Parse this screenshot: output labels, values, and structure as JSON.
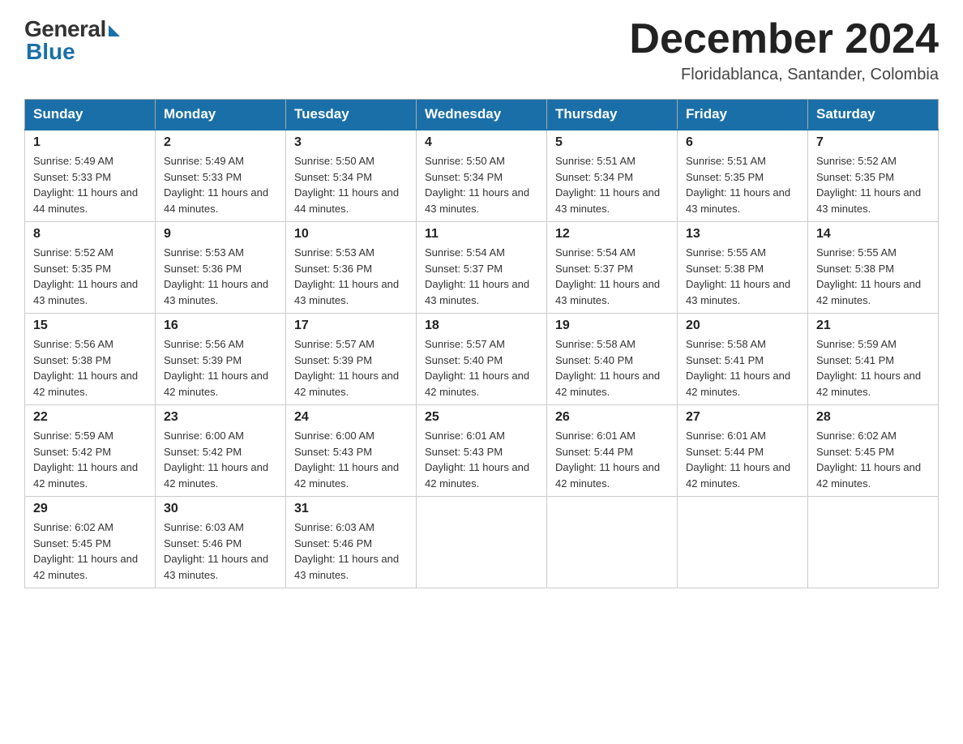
{
  "header": {
    "logo": {
      "general": "General",
      "blue": "Blue"
    },
    "title": "December 2024",
    "location": "Floridablanca, Santander, Colombia"
  },
  "days_of_week": [
    "Sunday",
    "Monday",
    "Tuesday",
    "Wednesday",
    "Thursday",
    "Friday",
    "Saturday"
  ],
  "weeks": [
    [
      {
        "day": "1",
        "sunrise": "5:49 AM",
        "sunset": "5:33 PM",
        "daylight": "11 hours and 44 minutes."
      },
      {
        "day": "2",
        "sunrise": "5:49 AM",
        "sunset": "5:33 PM",
        "daylight": "11 hours and 44 minutes."
      },
      {
        "day": "3",
        "sunrise": "5:50 AM",
        "sunset": "5:34 PM",
        "daylight": "11 hours and 44 minutes."
      },
      {
        "day": "4",
        "sunrise": "5:50 AM",
        "sunset": "5:34 PM",
        "daylight": "11 hours and 43 minutes."
      },
      {
        "day": "5",
        "sunrise": "5:51 AM",
        "sunset": "5:34 PM",
        "daylight": "11 hours and 43 minutes."
      },
      {
        "day": "6",
        "sunrise": "5:51 AM",
        "sunset": "5:35 PM",
        "daylight": "11 hours and 43 minutes."
      },
      {
        "day": "7",
        "sunrise": "5:52 AM",
        "sunset": "5:35 PM",
        "daylight": "11 hours and 43 minutes."
      }
    ],
    [
      {
        "day": "8",
        "sunrise": "5:52 AM",
        "sunset": "5:35 PM",
        "daylight": "11 hours and 43 minutes."
      },
      {
        "day": "9",
        "sunrise": "5:53 AM",
        "sunset": "5:36 PM",
        "daylight": "11 hours and 43 minutes."
      },
      {
        "day": "10",
        "sunrise": "5:53 AM",
        "sunset": "5:36 PM",
        "daylight": "11 hours and 43 minutes."
      },
      {
        "day": "11",
        "sunrise": "5:54 AM",
        "sunset": "5:37 PM",
        "daylight": "11 hours and 43 minutes."
      },
      {
        "day": "12",
        "sunrise": "5:54 AM",
        "sunset": "5:37 PM",
        "daylight": "11 hours and 43 minutes."
      },
      {
        "day": "13",
        "sunrise": "5:55 AM",
        "sunset": "5:38 PM",
        "daylight": "11 hours and 43 minutes."
      },
      {
        "day": "14",
        "sunrise": "5:55 AM",
        "sunset": "5:38 PM",
        "daylight": "11 hours and 42 minutes."
      }
    ],
    [
      {
        "day": "15",
        "sunrise": "5:56 AM",
        "sunset": "5:38 PM",
        "daylight": "11 hours and 42 minutes."
      },
      {
        "day": "16",
        "sunrise": "5:56 AM",
        "sunset": "5:39 PM",
        "daylight": "11 hours and 42 minutes."
      },
      {
        "day": "17",
        "sunrise": "5:57 AM",
        "sunset": "5:39 PM",
        "daylight": "11 hours and 42 minutes."
      },
      {
        "day": "18",
        "sunrise": "5:57 AM",
        "sunset": "5:40 PM",
        "daylight": "11 hours and 42 minutes."
      },
      {
        "day": "19",
        "sunrise": "5:58 AM",
        "sunset": "5:40 PM",
        "daylight": "11 hours and 42 minutes."
      },
      {
        "day": "20",
        "sunrise": "5:58 AM",
        "sunset": "5:41 PM",
        "daylight": "11 hours and 42 minutes."
      },
      {
        "day": "21",
        "sunrise": "5:59 AM",
        "sunset": "5:41 PM",
        "daylight": "11 hours and 42 minutes."
      }
    ],
    [
      {
        "day": "22",
        "sunrise": "5:59 AM",
        "sunset": "5:42 PM",
        "daylight": "11 hours and 42 minutes."
      },
      {
        "day": "23",
        "sunrise": "6:00 AM",
        "sunset": "5:42 PM",
        "daylight": "11 hours and 42 minutes."
      },
      {
        "day": "24",
        "sunrise": "6:00 AM",
        "sunset": "5:43 PM",
        "daylight": "11 hours and 42 minutes."
      },
      {
        "day": "25",
        "sunrise": "6:01 AM",
        "sunset": "5:43 PM",
        "daylight": "11 hours and 42 minutes."
      },
      {
        "day": "26",
        "sunrise": "6:01 AM",
        "sunset": "5:44 PM",
        "daylight": "11 hours and 42 minutes."
      },
      {
        "day": "27",
        "sunrise": "6:01 AM",
        "sunset": "5:44 PM",
        "daylight": "11 hours and 42 minutes."
      },
      {
        "day": "28",
        "sunrise": "6:02 AM",
        "sunset": "5:45 PM",
        "daylight": "11 hours and 42 minutes."
      }
    ],
    [
      {
        "day": "29",
        "sunrise": "6:02 AM",
        "sunset": "5:45 PM",
        "daylight": "11 hours and 42 minutes."
      },
      {
        "day": "30",
        "sunrise": "6:03 AM",
        "sunset": "5:46 PM",
        "daylight": "11 hours and 43 minutes."
      },
      {
        "day": "31",
        "sunrise": "6:03 AM",
        "sunset": "5:46 PM",
        "daylight": "11 hours and 43 minutes."
      },
      null,
      null,
      null,
      null
    ]
  ]
}
